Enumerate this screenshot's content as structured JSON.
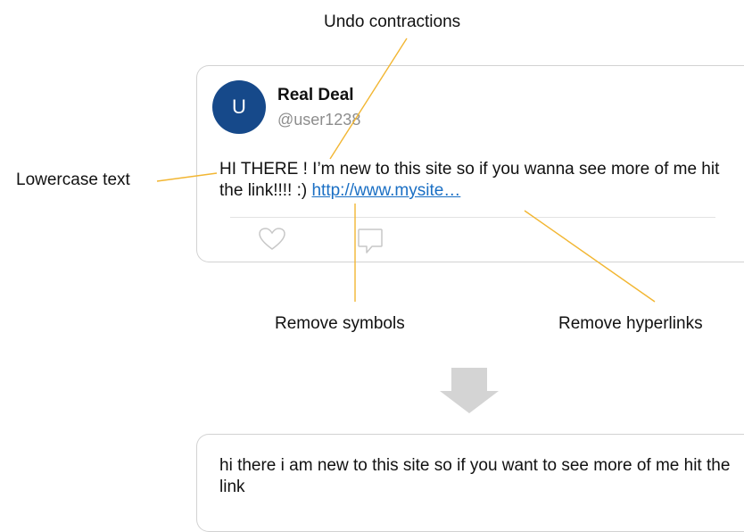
{
  "annotations": {
    "undo_contractions": "Undo contractions",
    "lowercase_text": "Lowercase text",
    "remove_symbols": "Remove symbols",
    "remove_hyperlinks": "Remove hyperlinks"
  },
  "tweet": {
    "avatar_letter": "U",
    "display_name": "Real Deal",
    "handle": "@user1238",
    "text": "HI THERE ! I’m new to this site so if you wanna see more of me hit the link!!!! :) ",
    "link_text": "http://www.mysite…",
    "icons": [
      "heart-icon",
      "comment-icon"
    ]
  },
  "result": {
    "text": "hi there i am new to this site so if you want to see more of me hit the link"
  },
  "colors": {
    "accent_line": "#f2b632",
    "avatar": "#16498a",
    "link": "#1a6fc4",
    "arrow": "#d4d4d4"
  }
}
